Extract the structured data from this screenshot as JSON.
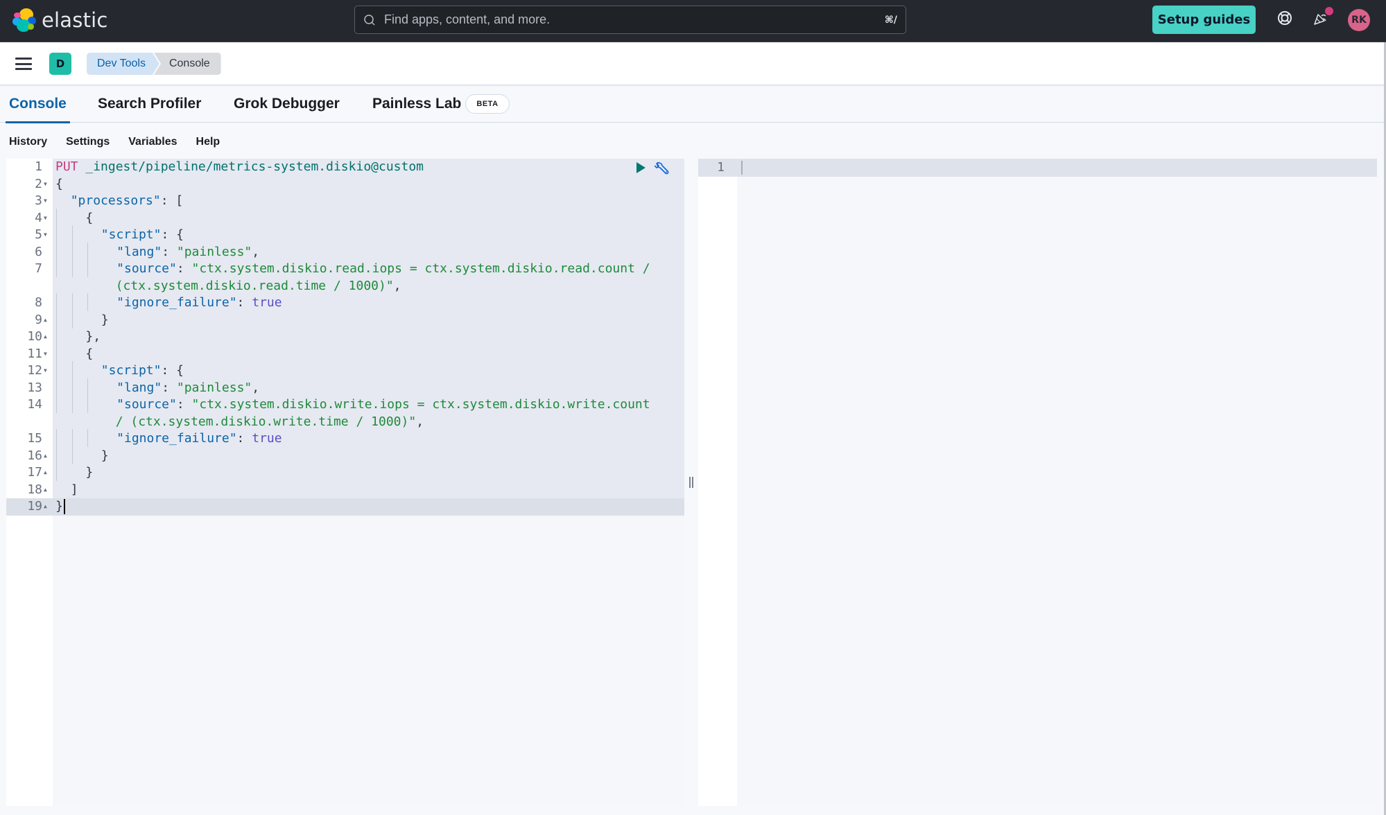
{
  "header": {
    "logo_text": "elastic",
    "search_placeholder": "Find apps, content, and more.",
    "search_shortcut": "⌘/",
    "setup_guides_label": "Setup guides",
    "help_icon": "lifebuoy-icon",
    "news_icon": "party-popper-icon",
    "avatar_initials": "RK"
  },
  "subheader": {
    "space_initial": "D",
    "breadcrumbs": [
      {
        "label": "Dev Tools"
      },
      {
        "label": "Console"
      }
    ]
  },
  "tabs": [
    {
      "label": "Console",
      "active": true
    },
    {
      "label": "Search Profiler",
      "active": false
    },
    {
      "label": "Grok Debugger",
      "active": false
    },
    {
      "label": "Painless Lab",
      "active": false,
      "badge": "BETA"
    }
  ],
  "toolbar": {
    "items": [
      "History",
      "Settings",
      "Variables",
      "Help"
    ]
  },
  "request_editor": {
    "lines": [
      {
        "n": "1",
        "fold": "",
        "indent": 0,
        "tokens": [
          [
            "method",
            "PUT"
          ],
          [
            "url",
            " _ingest/pipeline/metrics-system.diskio@custom"
          ]
        ]
      },
      {
        "n": "2",
        "fold": "▼",
        "indent": 0,
        "tokens": [
          [
            "punc",
            "{"
          ]
        ]
      },
      {
        "n": "3",
        "fold": "▼",
        "indent": 0,
        "lead": "  ",
        "tokens": [
          [
            "key",
            "\"processors\""
          ],
          [
            "punc",
            ": ["
          ]
        ]
      },
      {
        "n": "4",
        "fold": "▼",
        "indent": 1,
        "tokens": [
          [
            "punc",
            "{"
          ]
        ]
      },
      {
        "n": "5",
        "fold": "▼",
        "indent": 2,
        "tokens": [
          [
            "key",
            "\"script\""
          ],
          [
            "punc",
            ": {"
          ]
        ]
      },
      {
        "n": "6",
        "fold": "",
        "indent": 3,
        "tokens": [
          [
            "key",
            "\"lang\""
          ],
          [
            "punc",
            ": "
          ],
          [
            "str2",
            "\"painless\""
          ],
          [
            "punc",
            ","
          ]
        ]
      },
      {
        "n": "7",
        "fold": "",
        "indent": 3,
        "tokens": [
          [
            "key",
            "\"source\""
          ],
          [
            "punc",
            ": "
          ],
          [
            "str2",
            "\"ctx.system.diskio.read.iops = ctx.system.diskio.read.count /"
          ]
        ]
      },
      {
        "n": "",
        "fold": "",
        "indent": 0,
        "lead": "        ",
        "tokens": [
          [
            "str2",
            "(ctx.system.diskio.read.time / 1000)\""
          ],
          [
            "punc",
            ","
          ]
        ]
      },
      {
        "n": "8",
        "fold": "",
        "indent": 3,
        "tokens": [
          [
            "key",
            "\"ignore_failure\""
          ],
          [
            "punc",
            ": "
          ],
          [
            "bool",
            "true"
          ]
        ]
      },
      {
        "n": "9",
        "fold": "▲",
        "indent": 2,
        "tokens": [
          [
            "punc",
            "}"
          ]
        ]
      },
      {
        "n": "10",
        "fold": "▲",
        "indent": 1,
        "tokens": [
          [
            "punc",
            "},"
          ]
        ]
      },
      {
        "n": "11",
        "fold": "▼",
        "indent": 1,
        "tokens": [
          [
            "punc",
            "{"
          ]
        ]
      },
      {
        "n": "12",
        "fold": "▼",
        "indent": 2,
        "tokens": [
          [
            "key",
            "\"script\""
          ],
          [
            "punc",
            ": {"
          ]
        ]
      },
      {
        "n": "13",
        "fold": "",
        "indent": 3,
        "tokens": [
          [
            "key",
            "\"lang\""
          ],
          [
            "punc",
            ": "
          ],
          [
            "str2",
            "\"painless\""
          ],
          [
            "punc",
            ","
          ]
        ]
      },
      {
        "n": "14",
        "fold": "",
        "indent": 3,
        "tokens": [
          [
            "key",
            "\"source\""
          ],
          [
            "punc",
            ": "
          ],
          [
            "str2",
            "\"ctx.system.diskio.write.iops = ctx.system.diskio.write.count"
          ]
        ]
      },
      {
        "n": "",
        "fold": "",
        "indent": 0,
        "lead": "        ",
        "tokens": [
          [
            "str2",
            "/ (ctx.system.diskio.write.time / 1000)\""
          ],
          [
            "punc",
            ","
          ]
        ]
      },
      {
        "n": "15",
        "fold": "",
        "indent": 3,
        "tokens": [
          [
            "key",
            "\"ignore_failure\""
          ],
          [
            "punc",
            ": "
          ],
          [
            "bool",
            "true"
          ]
        ]
      },
      {
        "n": "16",
        "fold": "▲",
        "indent": 2,
        "tokens": [
          [
            "punc",
            "}"
          ]
        ]
      },
      {
        "n": "17",
        "fold": "▲",
        "indent": 1,
        "tokens": [
          [
            "punc",
            "}"
          ]
        ]
      },
      {
        "n": "18",
        "fold": "▲",
        "indent": 0,
        "lead": "  ",
        "tokens": [
          [
            "punc",
            "]"
          ]
        ]
      },
      {
        "n": "19",
        "fold": "▲",
        "indent": 0,
        "tokens": [
          [
            "punc",
            "}"
          ]
        ],
        "cursor": true
      }
    ]
  },
  "response_editor": {
    "line_number": "1",
    "content": ""
  }
}
